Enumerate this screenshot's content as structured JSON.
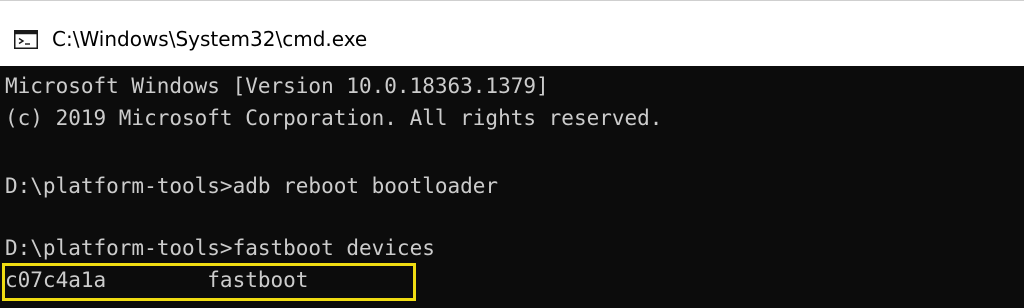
{
  "window": {
    "title": "C:\\Windows\\System32\\cmd.exe",
    "icon": "cmd-prompt-icon"
  },
  "console": {
    "lines": [
      "Microsoft Windows [Version 10.0.18363.1379]",
      "(c) 2019 Microsoft Corporation. All rights reserved.",
      "",
      "D:\\platform-tools>adb reboot bootloader",
      "",
      "D:\\platform-tools>fastboot devices",
      "c07c4a1a        fastboot"
    ]
  },
  "colors": {
    "background": "#0c0c0c",
    "text": "#cccccc",
    "highlight": "#f0dc12",
    "titlebar": "#ffffff"
  }
}
